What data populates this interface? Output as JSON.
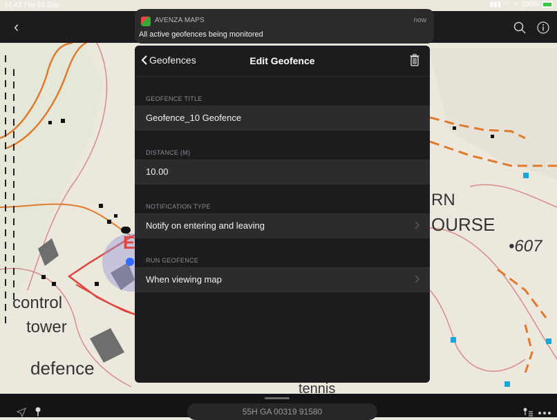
{
  "status_bar": {
    "time": "14:43  Thu 10 Sep",
    "battery": "100%"
  },
  "notification": {
    "app": "AVENZA MAPS",
    "time": "now",
    "message": "All active geofences being monitored"
  },
  "modal": {
    "back_label": "Geofences",
    "title": "Edit Geofence",
    "sections": [
      {
        "label": "GEOFENCE TITLE",
        "value": "Geofence_10 Geofence"
      },
      {
        "label": "DISTANCE (M)",
        "value": "10.00"
      },
      {
        "label": "NOTIFICATION TYPE",
        "value": "Notify on entering and leaving"
      },
      {
        "label": "RUN GEOFENCE",
        "value": "When viewing map"
      }
    ]
  },
  "map_labels": {
    "rn": "RN",
    "course": "OURSE",
    "elev": "•607",
    "control": "control",
    "tower": "tower",
    "defence": "defence",
    "tennis": "tennis",
    "e": "E"
  },
  "bottom_bar": {
    "coordinates": "55H GA 00319 91580"
  },
  "colors": {
    "accent": "#2f6bff",
    "map_red": "#e0463e",
    "map_orange": "#e07a2a",
    "map_cyan": "#19a7d8"
  }
}
